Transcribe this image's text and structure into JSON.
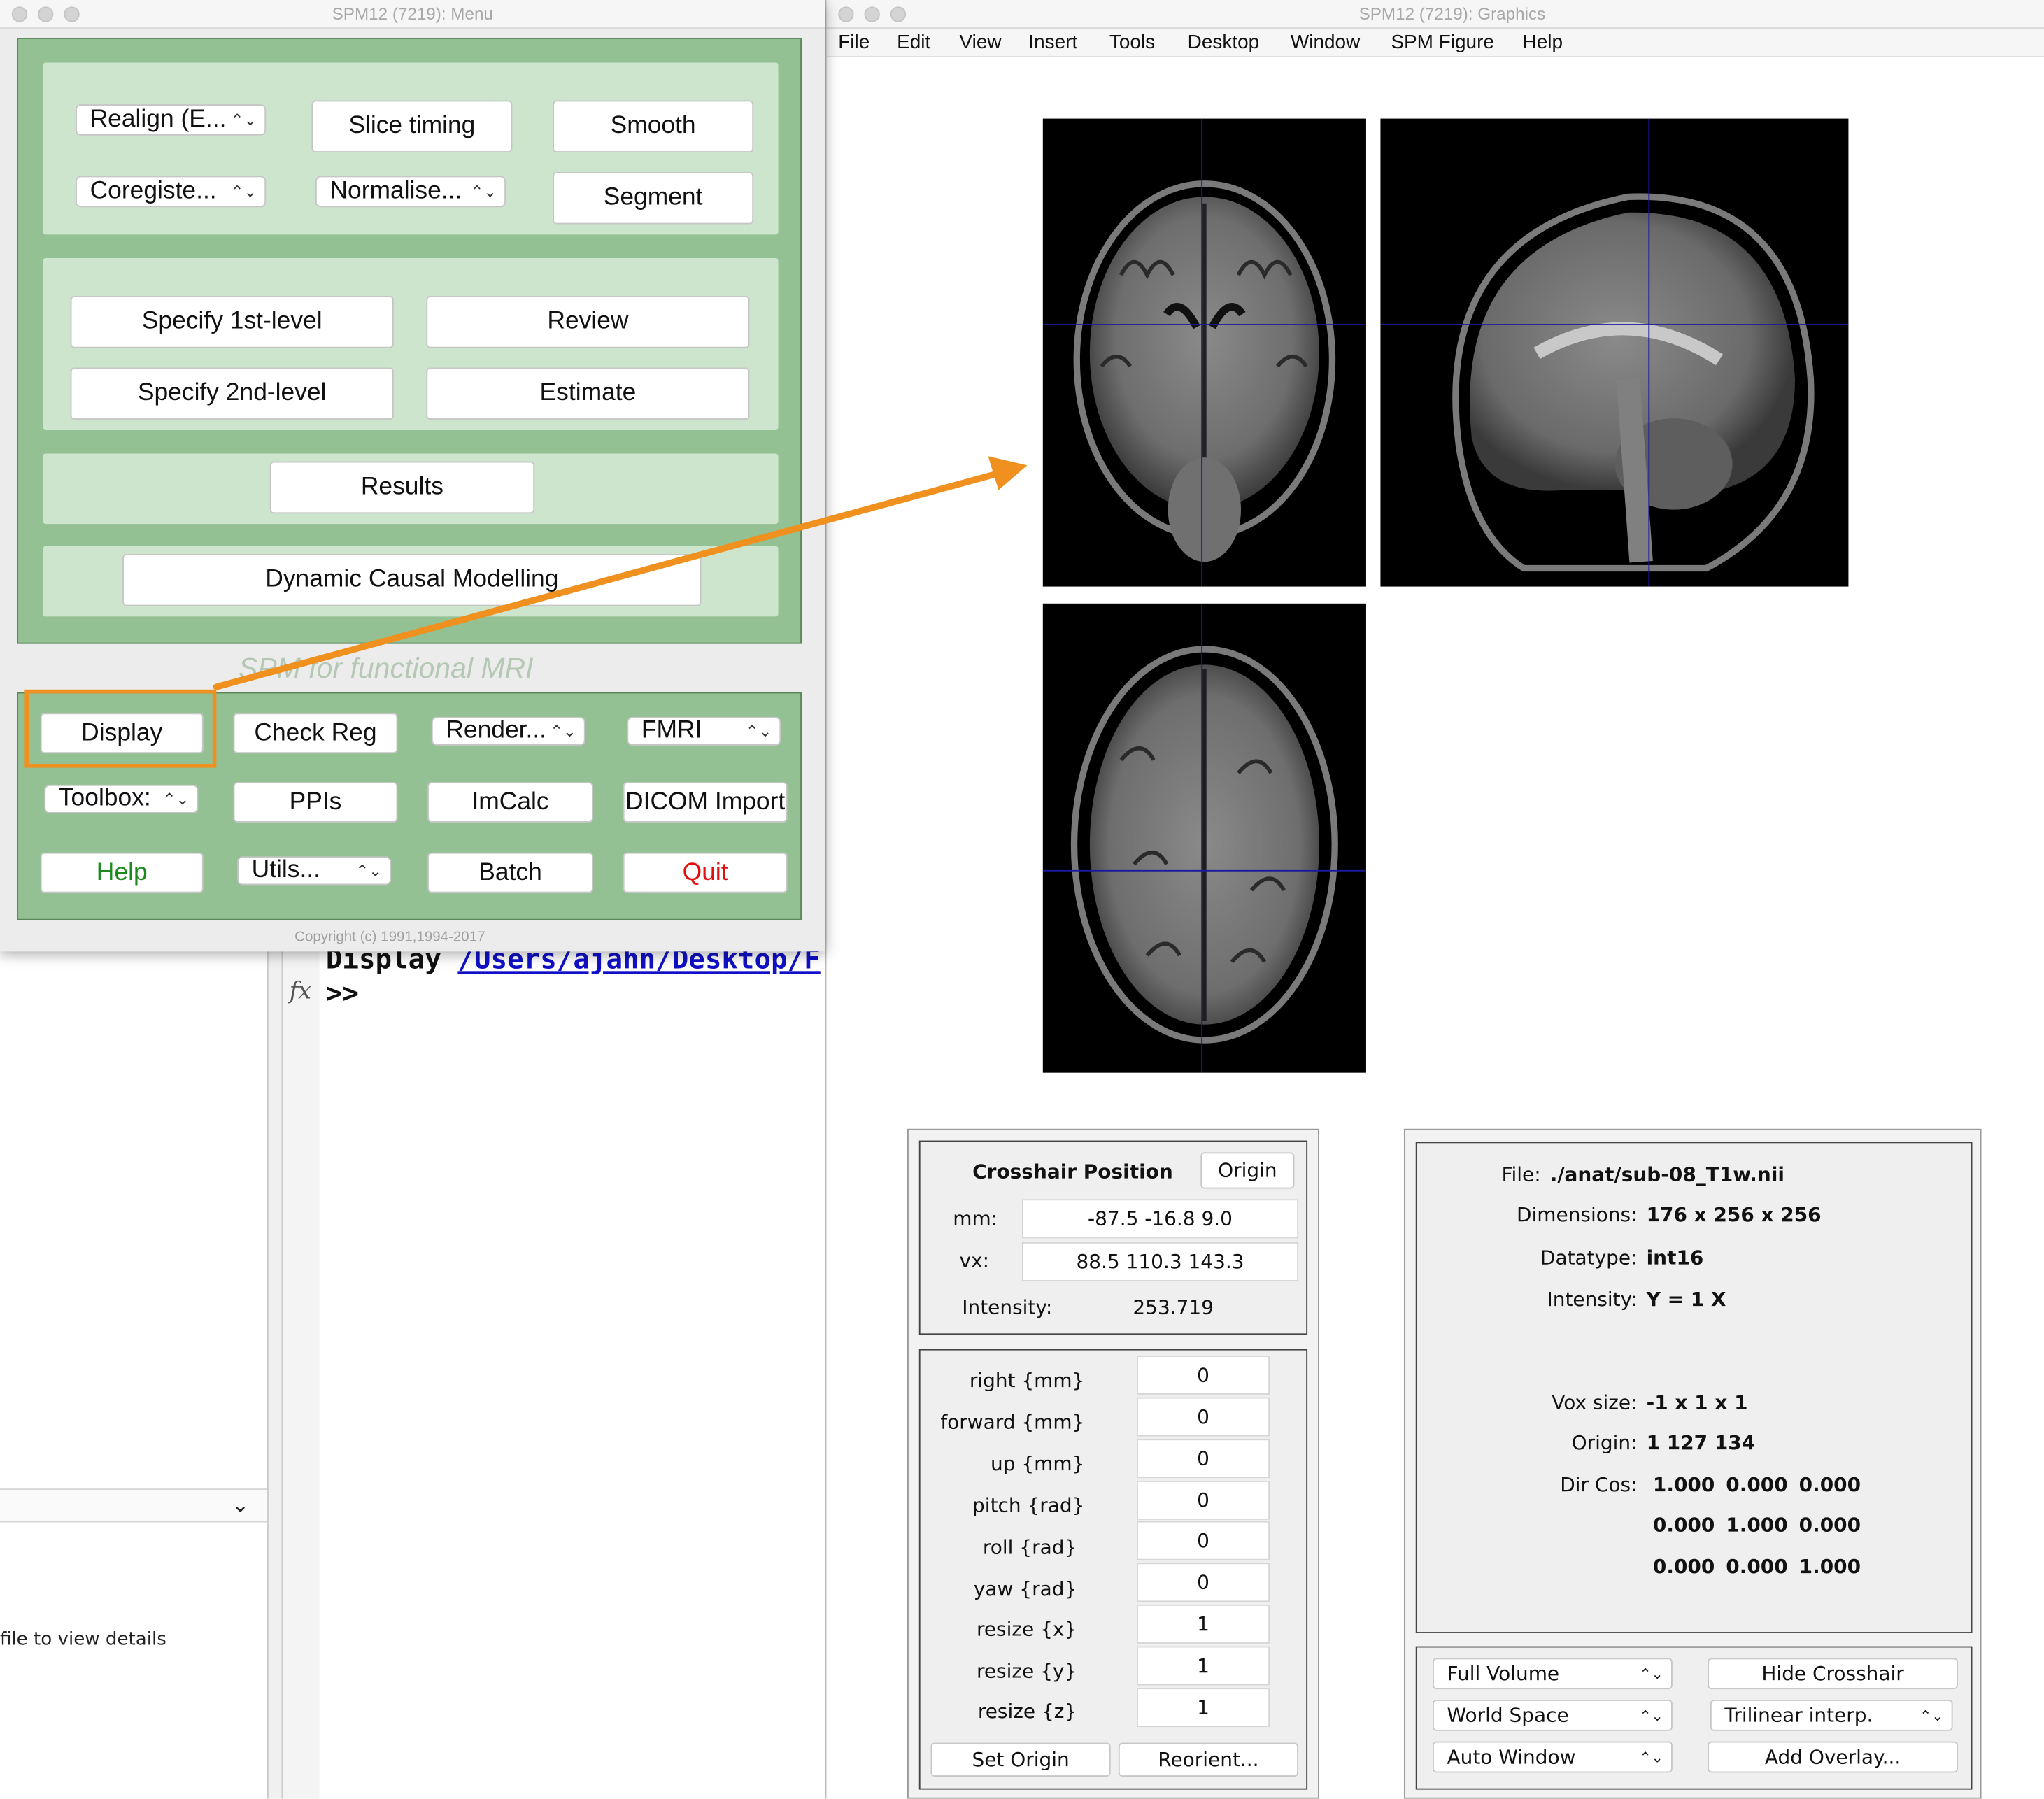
{
  "menu_window": {
    "title": "SPM12 (7219): Menu",
    "spatial": {
      "realign": "Realign (E...",
      "slice_timing": "Slice timing",
      "smooth": "Smooth",
      "coregister": "Coregiste...",
      "normalise": "Normalise...",
      "segment": "Segment"
    },
    "model": {
      "specify_1st": "Specify 1st-level",
      "review": "Review",
      "specify_2nd": "Specify 2nd-level",
      "estimate": "Estimate"
    },
    "results": "Results",
    "dcm": "Dynamic Causal Modelling",
    "tagline": "SPM for functional MRI",
    "tools": {
      "display": "Display",
      "check_reg": "Check Reg",
      "render": "Render...",
      "modality": "FMRI",
      "toolbox": "Toolbox:",
      "ppis": "PPIs",
      "imcalc": "ImCalc",
      "dicom_import": "DICOM Import",
      "help": "Help",
      "utils": "Utils...",
      "batch": "Batch",
      "quit": "Quit"
    },
    "copyright": "Copyright (c) 1991,1994-2017"
  },
  "command_window": {
    "command": "Display",
    "path": "/Users/ajahn/Desktop/F",
    "fx": "fx",
    "prompt": ">>",
    "details_hint": "file to view details"
  },
  "graphics_window": {
    "title": "SPM12 (7219): Graphics",
    "menu": [
      "File",
      "Edit",
      "View",
      "Insert",
      "Tools",
      "Desktop",
      "Window",
      "SPM Figure",
      "Help"
    ],
    "crosshair": {
      "heading": "Crosshair Position",
      "origin_button": "Origin",
      "mm_label": "mm:",
      "mm_value": "-87.5 -16.8 9.0",
      "vx_label": "vx:",
      "vx_value": "88.5 110.3 143.3",
      "intensity_label": "Intensity:",
      "intensity_value": "253.719"
    },
    "params": [
      {
        "label": "right  {mm}",
        "value": "0"
      },
      {
        "label": "forward  {mm}",
        "value": "0"
      },
      {
        "label": "up  {mm}",
        "value": "0"
      },
      {
        "label": "pitch  {rad}",
        "value": "0"
      },
      {
        "label": "roll  {rad}",
        "value": "0"
      },
      {
        "label": "yaw  {rad}",
        "value": "0"
      },
      {
        "label": "resize  {x}",
        "value": "1"
      },
      {
        "label": "resize  {y}",
        "value": "1"
      },
      {
        "label": "resize  {z}",
        "value": "1"
      }
    ],
    "set_origin": "Set Origin",
    "reorient": "Reorient...",
    "info": {
      "file_label": "File:",
      "file_value": "./anat/sub-08_T1w.nii",
      "dimensions_label": "Dimensions:",
      "dimensions_value": "176 x 256 x 256",
      "datatype_label": "Datatype:",
      "datatype_value": "int16",
      "intensity_label": "Intensity:",
      "intensity_value": "Y = 1 X",
      "voxsize_label": "Vox size:",
      "voxsize_value": "-1 x 1 x 1",
      "origin_label": "Origin:",
      "origin_value": "1 127 134",
      "dircos_label": "Dir Cos:",
      "dircos_rows": [
        [
          "1.000",
          "0.000",
          "0.000"
        ],
        [
          "0.000",
          "1.000",
          "0.000"
        ],
        [
          "0.000",
          "0.000",
          "1.000"
        ]
      ]
    },
    "controls": {
      "full_volume": "Full Volume",
      "hide_crosshair": "Hide Crosshair",
      "world_space": "World Space",
      "interp": "Trilinear interp.",
      "auto_window": "Auto Window",
      "add_overlay": "Add Overlay..."
    }
  },
  "colors": {
    "menu_green": "#93c193",
    "pane_green": "#cde4cd",
    "highlight_orange": "#f0901e",
    "help_green": "#1a8a1a",
    "quit_red": "#e01010"
  }
}
